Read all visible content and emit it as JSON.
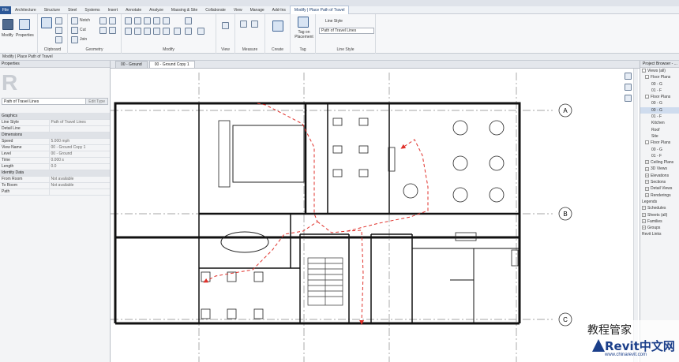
{
  "ribbon_tabs": [
    "File",
    "Architecture",
    "Structure",
    "Steel",
    "Systems",
    "Insert",
    "Annotate",
    "Analyze",
    "Massing & Site",
    "Collaborate",
    "View",
    "Manage",
    "Add-Ins",
    "Modify | Place Path of Travel"
  ],
  "ribbon": {
    "panels": [
      "Clipboard",
      "Geometry",
      "Modify",
      "View",
      "Measure",
      "Create",
      "Tag",
      "Line Style"
    ],
    "modify_label": "Modify",
    "properties_label": "Properties",
    "paste_label": "Paste",
    "geometry_items": [
      "Notch",
      "Cut",
      "Join"
    ],
    "tag_label": "Tag on Placement",
    "line_style_label": "Line Style",
    "line_style_value": "Path of Travel Lines"
  },
  "context_bar": "Modify | Place Path of Travel",
  "properties": {
    "header": "Properties",
    "type_name": "Path of Travel Lines",
    "edit_type": "Edit Type",
    "rows": [
      {
        "group": true,
        "label": "Graphics"
      },
      {
        "label": "Line Style",
        "value": "Path of Travel Lines"
      },
      {
        "label": "Detail Line",
        "value": ""
      },
      {
        "group": true,
        "label": "Dimensions"
      },
      {
        "label": "Speed",
        "value": "5.000 mph"
      },
      {
        "label": "View Name",
        "value": "00 - Ground Copy 1"
      },
      {
        "label": "Level",
        "value": "00 - Ground"
      },
      {
        "label": "Time",
        "value": "0.000 s"
      },
      {
        "label": "Length",
        "value": "0.0"
      },
      {
        "group": true,
        "label": "Identity Data"
      },
      {
        "label": "From Room",
        "value": "Not available"
      },
      {
        "label": "To Room",
        "value": "Not available"
      },
      {
        "label": "Path",
        "value": ""
      }
    ]
  },
  "view_tabs": [
    "00 - Ground",
    "00 - Ground Copy 1"
  ],
  "grid_labels": [
    "A",
    "B",
    "C"
  ],
  "project_browser": {
    "header": "Project Browser - ...",
    "items": [
      {
        "label": "Views (all)",
        "indent": 0,
        "toggle": "-"
      },
      {
        "label": "Floor Plans",
        "indent": 1,
        "toggle": "-"
      },
      {
        "label": "00 - G",
        "indent": 3,
        "toggle": ""
      },
      {
        "label": "01 - F",
        "indent": 3,
        "toggle": ""
      },
      {
        "label": "Floor Plans",
        "indent": 1,
        "toggle": "-"
      },
      {
        "label": "00 - G",
        "indent": 3,
        "toggle": ""
      },
      {
        "label": "00 - G",
        "indent": 3,
        "toggle": "",
        "selected": true
      },
      {
        "label": "01 - F",
        "indent": 3,
        "toggle": ""
      },
      {
        "label": "Kitchen",
        "indent": 3,
        "toggle": ""
      },
      {
        "label": "Roof",
        "indent": 3,
        "toggle": ""
      },
      {
        "label": "Site",
        "indent": 3,
        "toggle": ""
      },
      {
        "label": "Floor Plans",
        "indent": 1,
        "toggle": "-"
      },
      {
        "label": "00 - G",
        "indent": 3,
        "toggle": ""
      },
      {
        "label": "01 - F",
        "indent": 3,
        "toggle": ""
      },
      {
        "label": "Ceiling Plans",
        "indent": 1,
        "toggle": "+"
      },
      {
        "label": "3D Views",
        "indent": 1,
        "toggle": "+"
      },
      {
        "label": "Elevations",
        "indent": 1,
        "toggle": "+"
      },
      {
        "label": "Sections",
        "indent": 1,
        "toggle": "+"
      },
      {
        "label": "Detail Views",
        "indent": 1,
        "toggle": "+"
      },
      {
        "label": "Renderings",
        "indent": 1,
        "toggle": "+"
      },
      {
        "label": "Legends",
        "indent": 0,
        "toggle": ""
      },
      {
        "label": "Schedules",
        "indent": 0,
        "toggle": "+"
      },
      {
        "label": "Sheets (all)",
        "indent": 0,
        "toggle": "+"
      },
      {
        "label": "Families",
        "indent": 0,
        "toggle": "+"
      },
      {
        "label": "Groups",
        "indent": 0,
        "toggle": "+"
      },
      {
        "label": "Revit Links",
        "indent": 0,
        "toggle": ""
      }
    ]
  },
  "watermark": {
    "cn": "教程管家",
    "logo": "Revit中文网",
    "url": "www.chinarevit.com"
  },
  "colors": {
    "path": "#e0312b",
    "accent": "#2b5797",
    "wall": "#111111"
  }
}
